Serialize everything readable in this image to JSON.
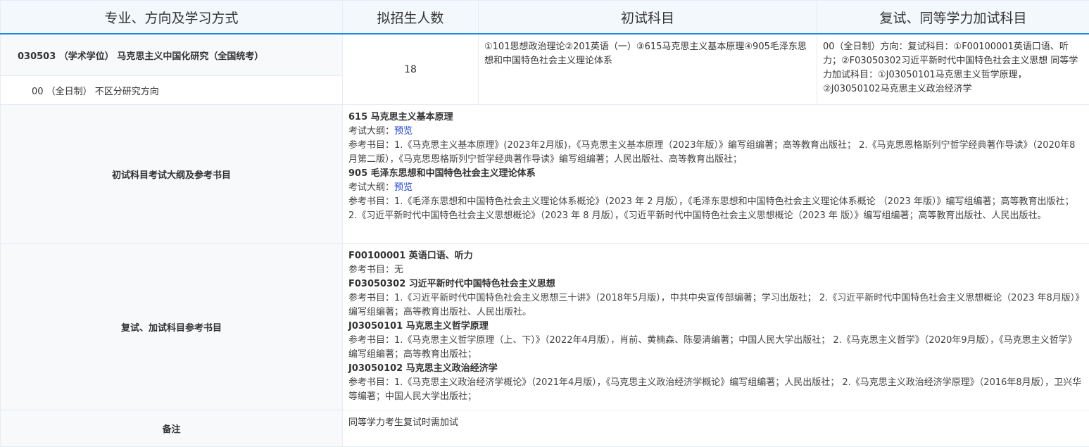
{
  "headers": {
    "program": "专业、方向及学习方式",
    "count": "拟招生人数",
    "prelim": "初试科目",
    "retest": "复试、同等学力加试科目"
  },
  "program": {
    "name": "030503 （学术学位） 马克思主义中国化研究（全国统考）",
    "direction": "00 （全日制） 不区分研究方向",
    "count": "18",
    "prelim_subjects": "①101思想政治理论②201英语（一）③615马克思主义基本原理④905毛泽东思想和中国特色社会主义理论体系",
    "retest_subjects": "00（全日制）方向：复试科目：①F00100001英语口语、听力；②F03050302习近平新时代中国特色社会主义思想 同等学力加试科目：①J03050101马克思主义哲学原理，②J03050102马克思主义政治经济学"
  },
  "prelim_section": {
    "label": "初试科目考试大纲及参考书目",
    "items": [
      {
        "title": "615 马克思主义基本原理",
        "outline_label": "考试大纲：",
        "outline_link": "预览",
        "refs": "参考书目：1.《马克思主义基本原理》(2023年2月版)，《马克思主义基本原理（2023年版）》编写组编著；高等教育出版社； 2.《马克思恩格斯列宁哲学经典著作导读》（2020年8月第二版），《马克思恩格斯列宁哲学经典著作导读》编写组编著；人民出版社、高等教育出版社；"
      },
      {
        "title": "905 毛泽东思想和中国特色社会主义理论体系",
        "outline_label": "考试大纲：",
        "outline_link": "预览",
        "refs": "参考书目：1.《毛泽东思想和中国特色社会主义理论体系概论》（2023 年 2 月版），《毛泽东思想和中国特色社会主义理论体系概论 （2023 年版）》编写组编著；高等教育出版社； 2.《习近平新时代中国特色社会主义思想概论》（2023 年 8 月版），《习近平新时代中国特色社会主义思想概论（2023 年 版）》编写组编著；高等教育出版社、人民出版社。"
      }
    ]
  },
  "retest_section": {
    "label": "复试、加试科目参考书目",
    "items": [
      {
        "title": "F00100001 英语口语、听力",
        "refs": "参考书目：无"
      },
      {
        "title": "F03050302 习近平新时代中国特色社会主义思想",
        "refs": "参考书目：1.《习近平新时代中国特色社会主义思想三十讲》（2018年5月版），中共中央宣传部编著；学习出版社； 2.《习近平新时代中国特色社会主义思想概论（2023 年8月版）》编写组编著；高等教育出版社、人民出版社。"
      },
      {
        "title": "J03050101 马克思主义哲学原理",
        "refs": "参考书目：1.《马克思主义哲学原理（上、下）》（2022年4月版），肖前、黄楠森、陈晏清编著；中国人民大学出版社； 2.《马克思主义哲学》（2020年9月版），《马克思主义哲学》编写组编著；高等教育出版社；"
      },
      {
        "title": "J03050102 马克思主义政治经济学",
        "refs": "参考书目：1.《马克思主义政治经济学概论》（2021年4月版），《马克思主义政治经济学概论》编写组编著；人民出版社； 2.《马克思主义政治经济学原理》（2016年8月版），卫兴华等编著；中国人民大学出版社；"
      }
    ]
  },
  "notes": {
    "label": "备注",
    "text": "同等学力考生复试时需加试"
  }
}
